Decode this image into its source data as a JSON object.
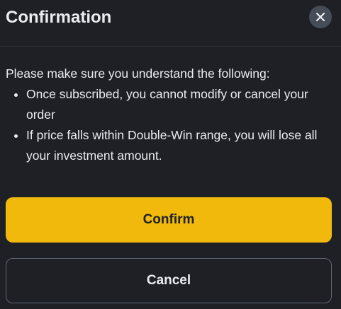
{
  "dialog": {
    "title": "Confirmation",
    "close_icon": "close-icon",
    "intro": "Please make sure you understand the following:",
    "bullets": [
      "Once subscribed, you cannot modify or cancel your order",
      "If price falls within Double-Win range, you will lose all your investment amount."
    ],
    "confirm_label": "Confirm",
    "cancel_label": "Cancel"
  },
  "colors": {
    "background": "#1e2026",
    "primary_accent": "#f0b90b",
    "text": "#eaecef",
    "close_button_bg": "#474d57"
  }
}
